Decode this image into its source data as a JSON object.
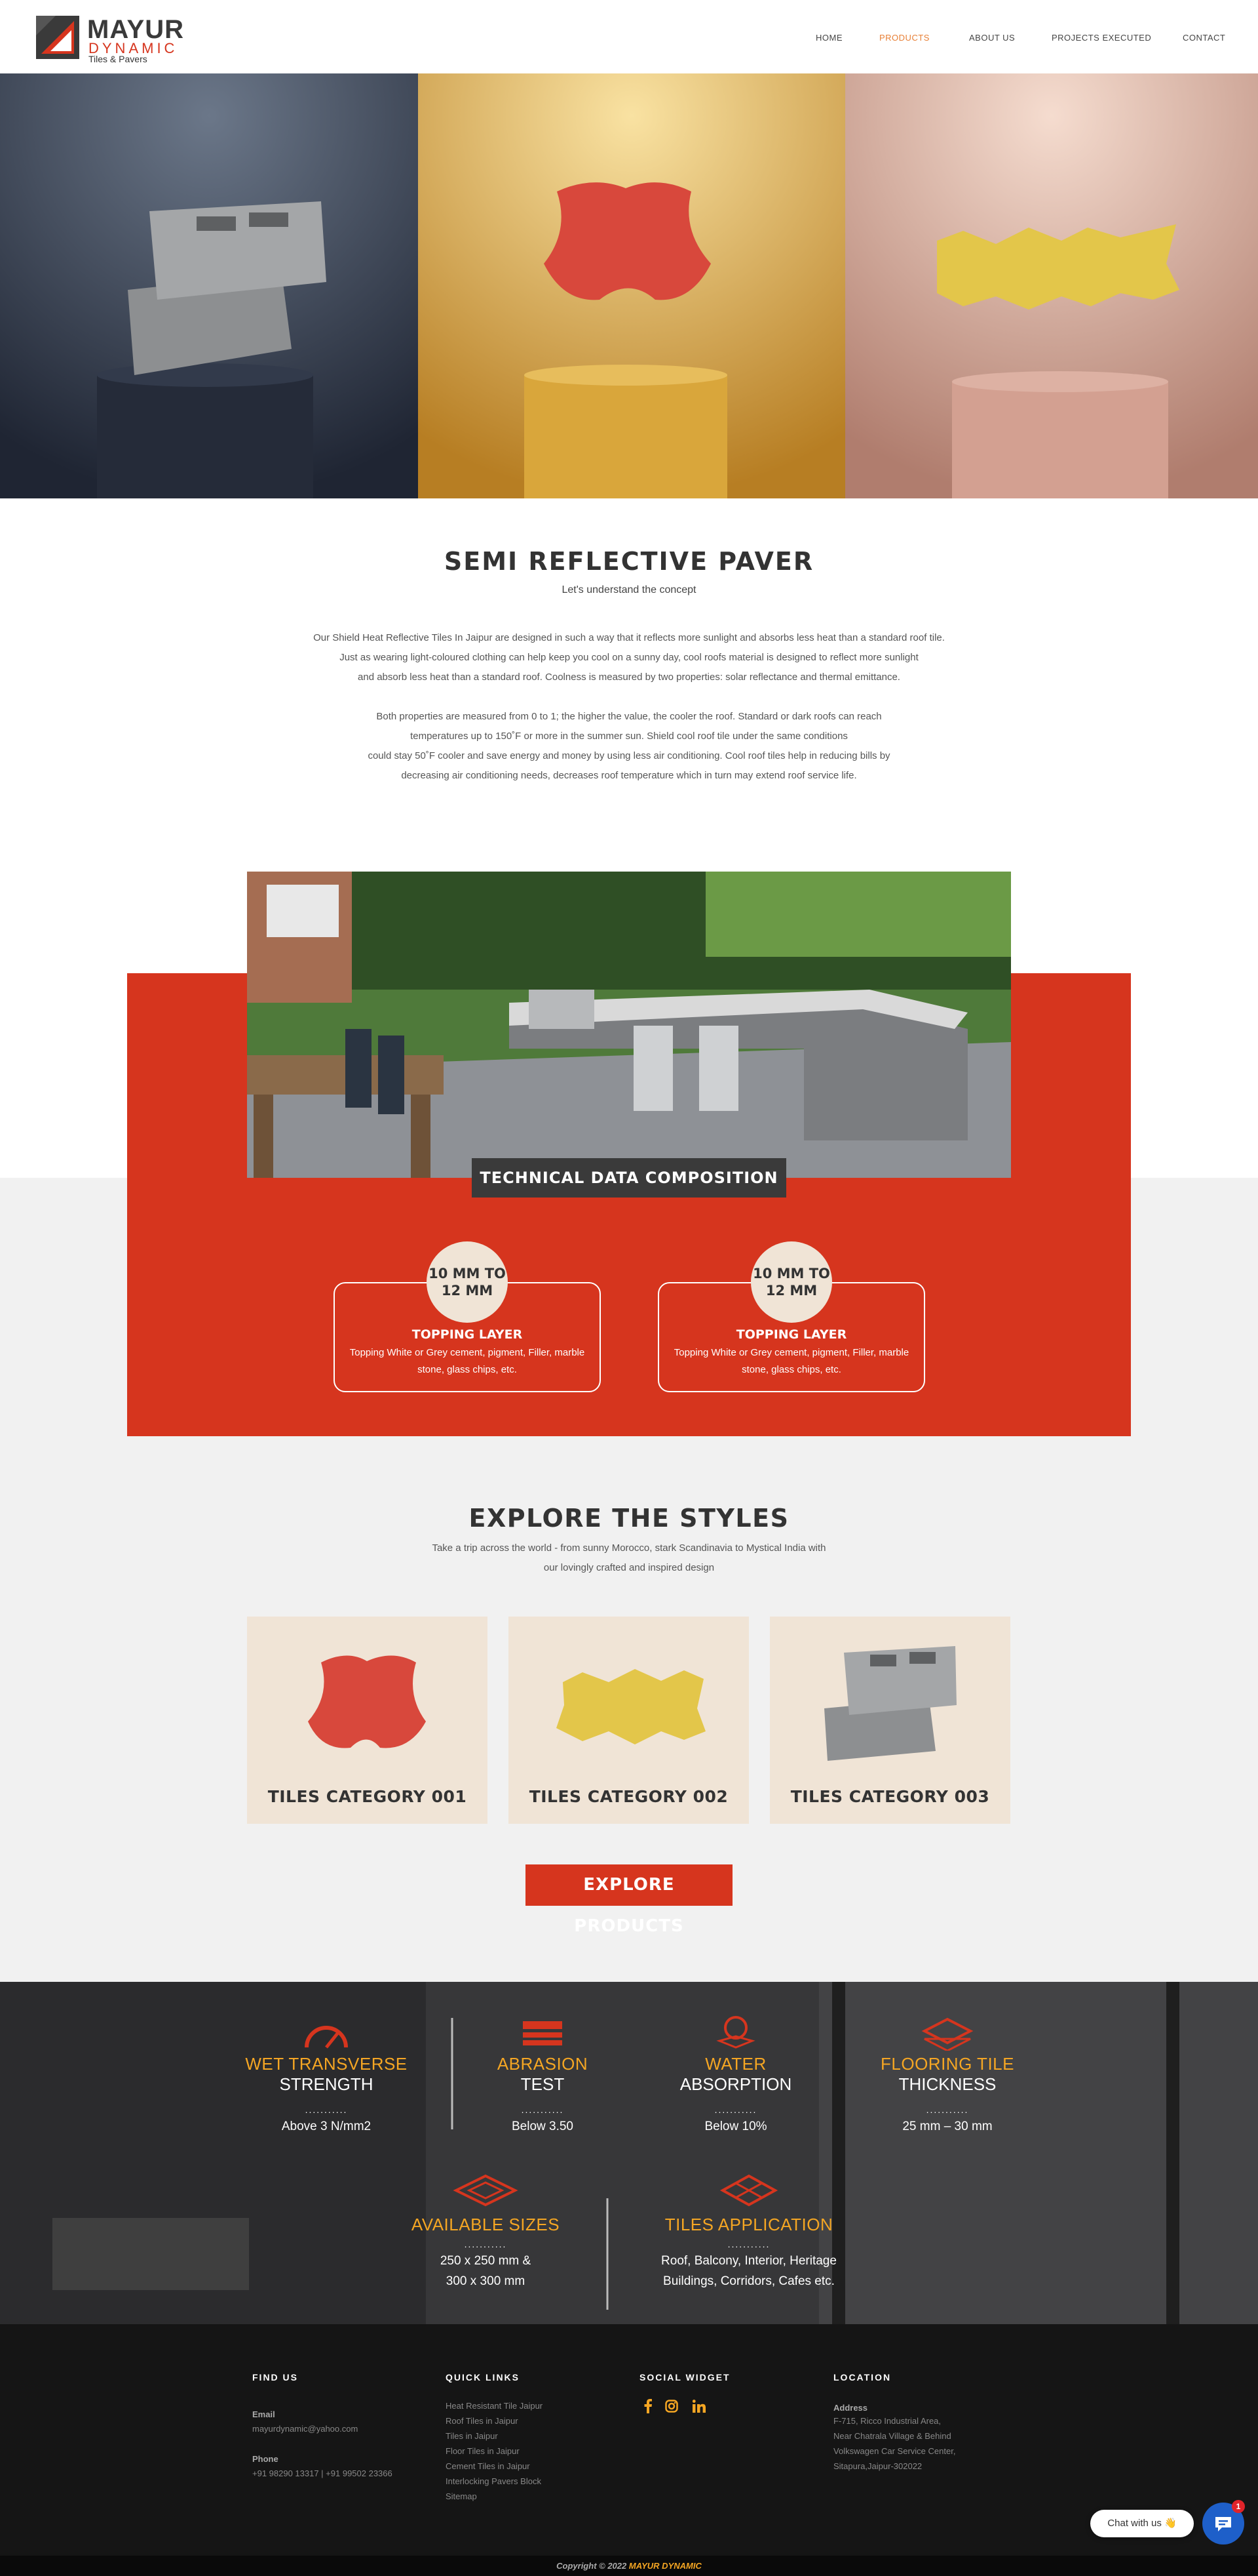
{
  "header": {
    "logo": {
      "name": "MAYUR",
      "sub": "DYNAMIC",
      "tagline": "Tiles & Pavers"
    },
    "nav": [
      {
        "label": "HOME",
        "active": false
      },
      {
        "label": "PRODUCTS",
        "active": true
      },
      {
        "label": "ABOUT US",
        "active": false
      },
      {
        "label": "PROJECTS EXECUTED",
        "active": false
      },
      {
        "label": "CONTACT",
        "active": false
      }
    ]
  },
  "colors": {
    "accent": "#d6351e",
    "orange": "#f5a623",
    "nav_active": "#e87f35",
    "beige": "#f0e4d6",
    "dark": "#151515"
  },
  "semi": {
    "title": "SEMI REFLECTIVE PAVER",
    "subtitle": "Let's understand the concept",
    "para1": [
      "Our Shield Heat Reflective Tiles In Jaipur are designed in such a way that it reflects more sunlight and absorbs less heat than a standard roof tile.",
      "Just as wearing light-coloured clothing can help keep you cool on a sunny day, cool roofs material is designed to reflect more sunlight",
      "and absorb less heat than a standard roof. Coolness is measured by two properties: solar reflectance and thermal emittance."
    ],
    "para2": [
      "Both properties are measured from 0 to 1; the higher the value, the cooler the roof. Standard or dark roofs can reach",
      "temperatures up to 150˚F or more in the summer sun. Shield cool roof tile under the same conditions",
      "could stay 50˚F cooler and save energy and money by using less air conditioning. Cool roof tiles help in reducing bills by",
      "decreasing air conditioning needs, decreases roof temperature which in turn may extend roof service life."
    ]
  },
  "technical": {
    "title": "TECHNICAL DATA COMPOSITION",
    "cards": [
      {
        "size_line1": "10 MM TO",
        "size_line2": "12 MM",
        "label": "TOPPING LAYER",
        "desc": "Topping White or Grey cement, pigment, Filler, marble stone, glass chips, etc."
      },
      {
        "size_line1": "10 MM TO",
        "size_line2": "12 MM",
        "label": "TOPPING LAYER",
        "desc": "Topping White or Grey cement, pigment, Filler, marble stone, glass chips, etc."
      }
    ]
  },
  "explore": {
    "title": "EXPLORE THE STYLES",
    "sub1": "Take a trip across the world - from sunny Morocco, stark Scandinavia to Mystical India with",
    "sub2": "our lovingly crafted and inspired design",
    "cards": [
      {
        "label": "TILES CATEGORY 001",
        "icon": "red-paver-icon"
      },
      {
        "label": "TILES CATEGORY 002",
        "icon": "yellow-paver-icon"
      },
      {
        "label": "TILES CATEGORY 003",
        "icon": "concrete-block-icon"
      }
    ],
    "button": "EXPLORE PRODUCTS"
  },
  "stats": [
    {
      "orange": "WET TRANSVERSE",
      "white": "STRENGTH",
      "value1": "Above 3 N/mm2",
      "value2": "",
      "icon": "gauge-icon"
    },
    {
      "orange": "ABRASION",
      "white": "TEST",
      "value1": "Below 3.50",
      "value2": "",
      "icon": "abrasion-icon"
    },
    {
      "orange": "WATER",
      "white": "ABSORPTION",
      "value1": "Below 10%",
      "value2": "",
      "icon": "water-drop-icon"
    },
    {
      "orange": "FLOORING TILE",
      "white": "THICKNESS",
      "value1": "25 mm – 30 mm",
      "value2": "",
      "icon": "tile-layers-icon"
    },
    {
      "orange": "AVAILABLE SIZES",
      "white": "",
      "value1": "250 x 250 mm &",
      "value2": "300 x 300 mm",
      "icon": "tile-size-icon"
    },
    {
      "orange": "TILES APPLICATION",
      "white": "",
      "value1": "Roof, Balcony, Interior, Heritage",
      "value2": "Buildings, Corridors, Cafes etc.",
      "icon": "tile-apply-icon"
    }
  ],
  "footer": {
    "find_us": {
      "title": "FIND US",
      "email_label": "Email",
      "email": "mayurdynamic@yahoo.com",
      "phone_label": "Phone",
      "phone": "+91 98290 13317 | +91 99502 23366"
    },
    "quick_links": {
      "title": "QUICK LINKS",
      "items": [
        "Heat Resistant Tile Jaipur",
        "Roof Tiles in Jaipur",
        "Tiles in Jaipur",
        "Floor Tiles in Jaipur",
        "Cement Tiles in Jaipur",
        "Interlocking Pavers Block",
        "Sitemap"
      ]
    },
    "social": {
      "title": "SOCIAL WIDGET",
      "icons": [
        "facebook-icon",
        "instagram-icon",
        "linkedin-icon"
      ]
    },
    "location": {
      "title": "LOCATION",
      "label": "Address",
      "lines": [
        "F-715, Ricco Industrial Area,",
        "Near Chatrala Village & Behind",
        "Volkswagen Car Service Center,",
        "Sitapura,Jaipur-302022"
      ]
    },
    "copyright_prefix": "Copyright © 2022",
    "copyright_brand": "MAYUR DYNAMIC"
  },
  "chat": {
    "label": "Chat with us 👋",
    "badge": "1"
  }
}
